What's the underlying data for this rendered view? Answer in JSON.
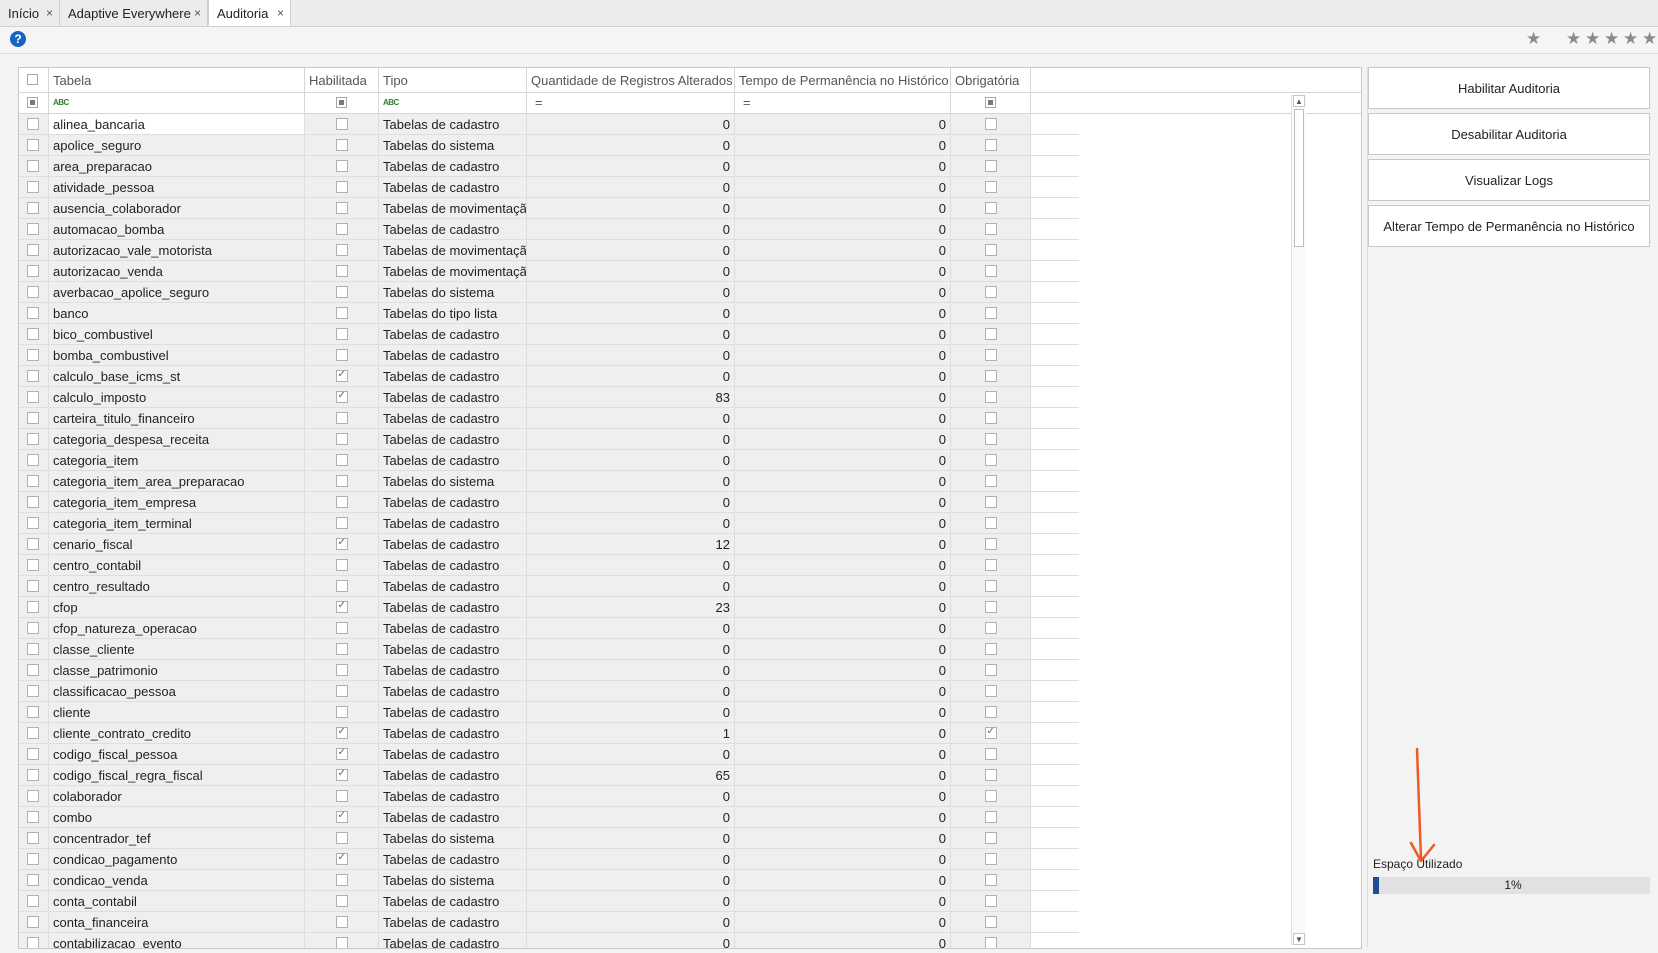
{
  "tabs": [
    {
      "label": "Início"
    },
    {
      "label": "Adaptive Everywhere"
    },
    {
      "label": "Auditoria"
    }
  ],
  "tab_close_glyph": "×",
  "toolbar": {
    "help_glyph": "?",
    "favorite_glyph": "★",
    "rating_glyph": "★",
    "rating_stars": 5,
    "rating_filled": 0
  },
  "grid": {
    "columns": [
      "Tabela",
      "Habilitada",
      "Tipo",
      "Quantidade de Registros Alterados",
      "Tempo de Permanência no Histórico",
      "Obrigatória"
    ],
    "filter": {
      "text_icon": "ABC",
      "numeric_icon": "="
    },
    "rows": [
      {
        "tabela": "alinea_bancaria",
        "habilitada": false,
        "tipo": "Tabelas de cadastro",
        "qtd": "0",
        "tempo": "0",
        "obrigatoria": false
      },
      {
        "tabela": "apolice_seguro",
        "habilitada": false,
        "tipo": "Tabelas do sistema",
        "qtd": "0",
        "tempo": "0",
        "obrigatoria": false
      },
      {
        "tabela": "area_preparacao",
        "habilitada": false,
        "tipo": "Tabelas de cadastro",
        "qtd": "0",
        "tempo": "0",
        "obrigatoria": false
      },
      {
        "tabela": "atividade_pessoa",
        "habilitada": false,
        "tipo": "Tabelas de cadastro",
        "qtd": "0",
        "tempo": "0",
        "obrigatoria": false
      },
      {
        "tabela": "ausencia_colaborador",
        "habilitada": false,
        "tipo": "Tabelas de movimentação",
        "qtd": "0",
        "tempo": "0",
        "obrigatoria": false
      },
      {
        "tabela": "automacao_bomba",
        "habilitada": false,
        "tipo": "Tabelas de cadastro",
        "qtd": "0",
        "tempo": "0",
        "obrigatoria": false
      },
      {
        "tabela": "autorizacao_vale_motorista",
        "habilitada": false,
        "tipo": "Tabelas de movimentação",
        "qtd": "0",
        "tempo": "0",
        "obrigatoria": false
      },
      {
        "tabela": "autorizacao_venda",
        "habilitada": false,
        "tipo": "Tabelas de movimentação",
        "qtd": "0",
        "tempo": "0",
        "obrigatoria": false
      },
      {
        "tabela": "averbacao_apolice_seguro",
        "habilitada": false,
        "tipo": "Tabelas do sistema",
        "qtd": "0",
        "tempo": "0",
        "obrigatoria": false
      },
      {
        "tabela": "banco",
        "habilitada": false,
        "tipo": "Tabelas do tipo lista",
        "qtd": "0",
        "tempo": "0",
        "obrigatoria": false
      },
      {
        "tabela": "bico_combustivel",
        "habilitada": false,
        "tipo": "Tabelas de cadastro",
        "qtd": "0",
        "tempo": "0",
        "obrigatoria": false
      },
      {
        "tabela": "bomba_combustivel",
        "habilitada": false,
        "tipo": "Tabelas de cadastro",
        "qtd": "0",
        "tempo": "0",
        "obrigatoria": false
      },
      {
        "tabela": "calculo_base_icms_st",
        "habilitada": true,
        "tipo": "Tabelas de cadastro",
        "qtd": "0",
        "tempo": "0",
        "obrigatoria": false
      },
      {
        "tabela": "calculo_imposto",
        "habilitada": true,
        "tipo": "Tabelas de cadastro",
        "qtd": "83",
        "tempo": "0",
        "obrigatoria": false
      },
      {
        "tabela": "carteira_titulo_financeiro",
        "habilitada": false,
        "tipo": "Tabelas de cadastro",
        "qtd": "0",
        "tempo": "0",
        "obrigatoria": false
      },
      {
        "tabela": "categoria_despesa_receita",
        "habilitada": false,
        "tipo": "Tabelas de cadastro",
        "qtd": "0",
        "tempo": "0",
        "obrigatoria": false
      },
      {
        "tabela": "categoria_item",
        "habilitada": false,
        "tipo": "Tabelas de cadastro",
        "qtd": "0",
        "tempo": "0",
        "obrigatoria": false
      },
      {
        "tabela": "categoria_item_area_preparacao",
        "habilitada": false,
        "tipo": "Tabelas do sistema",
        "qtd": "0",
        "tempo": "0",
        "obrigatoria": false
      },
      {
        "tabela": "categoria_item_empresa",
        "habilitada": false,
        "tipo": "Tabelas de cadastro",
        "qtd": "0",
        "tempo": "0",
        "obrigatoria": false
      },
      {
        "tabela": "categoria_item_terminal",
        "habilitada": false,
        "tipo": "Tabelas de cadastro",
        "qtd": "0",
        "tempo": "0",
        "obrigatoria": false
      },
      {
        "tabela": "cenario_fiscal",
        "habilitada": true,
        "tipo": "Tabelas de cadastro",
        "qtd": "12",
        "tempo": "0",
        "obrigatoria": false
      },
      {
        "tabela": "centro_contabil",
        "habilitada": false,
        "tipo": "Tabelas de cadastro",
        "qtd": "0",
        "tempo": "0",
        "obrigatoria": false
      },
      {
        "tabela": "centro_resultado",
        "habilitada": false,
        "tipo": "Tabelas de cadastro",
        "qtd": "0",
        "tempo": "0",
        "obrigatoria": false
      },
      {
        "tabela": "cfop",
        "habilitada": true,
        "tipo": "Tabelas de cadastro",
        "qtd": "23",
        "tempo": "0",
        "obrigatoria": false
      },
      {
        "tabela": "cfop_natureza_operacao",
        "habilitada": false,
        "tipo": "Tabelas de cadastro",
        "qtd": "0",
        "tempo": "0",
        "obrigatoria": false
      },
      {
        "tabela": "classe_cliente",
        "habilitada": false,
        "tipo": "Tabelas de cadastro",
        "qtd": "0",
        "tempo": "0",
        "obrigatoria": false
      },
      {
        "tabela": "classe_patrimonio",
        "habilitada": false,
        "tipo": "Tabelas de cadastro",
        "qtd": "0",
        "tempo": "0",
        "obrigatoria": false
      },
      {
        "tabela": "classificacao_pessoa",
        "habilitada": false,
        "tipo": "Tabelas de cadastro",
        "qtd": "0",
        "tempo": "0",
        "obrigatoria": false
      },
      {
        "tabela": "cliente",
        "habilitada": false,
        "tipo": "Tabelas de cadastro",
        "qtd": "0",
        "tempo": "0",
        "obrigatoria": false
      },
      {
        "tabela": "cliente_contrato_credito",
        "habilitada": true,
        "tipo": "Tabelas de cadastro",
        "qtd": "1",
        "tempo": "0",
        "obrigatoria": true
      },
      {
        "tabela": "codigo_fiscal_pessoa",
        "habilitada": true,
        "tipo": "Tabelas de cadastro",
        "qtd": "0",
        "tempo": "0",
        "obrigatoria": false
      },
      {
        "tabela": "codigo_fiscal_regra_fiscal",
        "habilitada": true,
        "tipo": "Tabelas de cadastro",
        "qtd": "65",
        "tempo": "0",
        "obrigatoria": false
      },
      {
        "tabela": "colaborador",
        "habilitada": false,
        "tipo": "Tabelas de cadastro",
        "qtd": "0",
        "tempo": "0",
        "obrigatoria": false
      },
      {
        "tabela": "combo",
        "habilitada": true,
        "tipo": "Tabelas de cadastro",
        "qtd": "0",
        "tempo": "0",
        "obrigatoria": false
      },
      {
        "tabela": "concentrador_tef",
        "habilitada": false,
        "tipo": "Tabelas do sistema",
        "qtd": "0",
        "tempo": "0",
        "obrigatoria": false
      },
      {
        "tabela": "condicao_pagamento",
        "habilitada": true,
        "tipo": "Tabelas de cadastro",
        "qtd": "0",
        "tempo": "0",
        "obrigatoria": false
      },
      {
        "tabela": "condicao_venda",
        "habilitada": false,
        "tipo": "Tabelas do sistema",
        "qtd": "0",
        "tempo": "0",
        "obrigatoria": false
      },
      {
        "tabela": "conta_contabil",
        "habilitada": false,
        "tipo": "Tabelas de cadastro",
        "qtd": "0",
        "tempo": "0",
        "obrigatoria": false
      },
      {
        "tabela": "conta_financeira",
        "habilitada": false,
        "tipo": "Tabelas de cadastro",
        "qtd": "0",
        "tempo": "0",
        "obrigatoria": false
      },
      {
        "tabela": "contabilizacao_evento",
        "habilitada": false,
        "tipo": "Tabelas de cadastro",
        "qtd": "0",
        "tempo": "0",
        "obrigatoria": false
      }
    ]
  },
  "actions": {
    "habilitar": "Habilitar Auditoria",
    "desabilitar": "Desabilitar Auditoria",
    "logs": "Visualizar Logs",
    "alterar_tempo": "Alterar Tempo de Permanência no Histórico"
  },
  "usage": {
    "label": "Espaço Utilizado",
    "percent": 1,
    "text": "1%"
  },
  "colors": {
    "accent_bar": "#1f4e96",
    "annotation_arrow": "#ee5a24",
    "help_icon": "#1565c0"
  }
}
